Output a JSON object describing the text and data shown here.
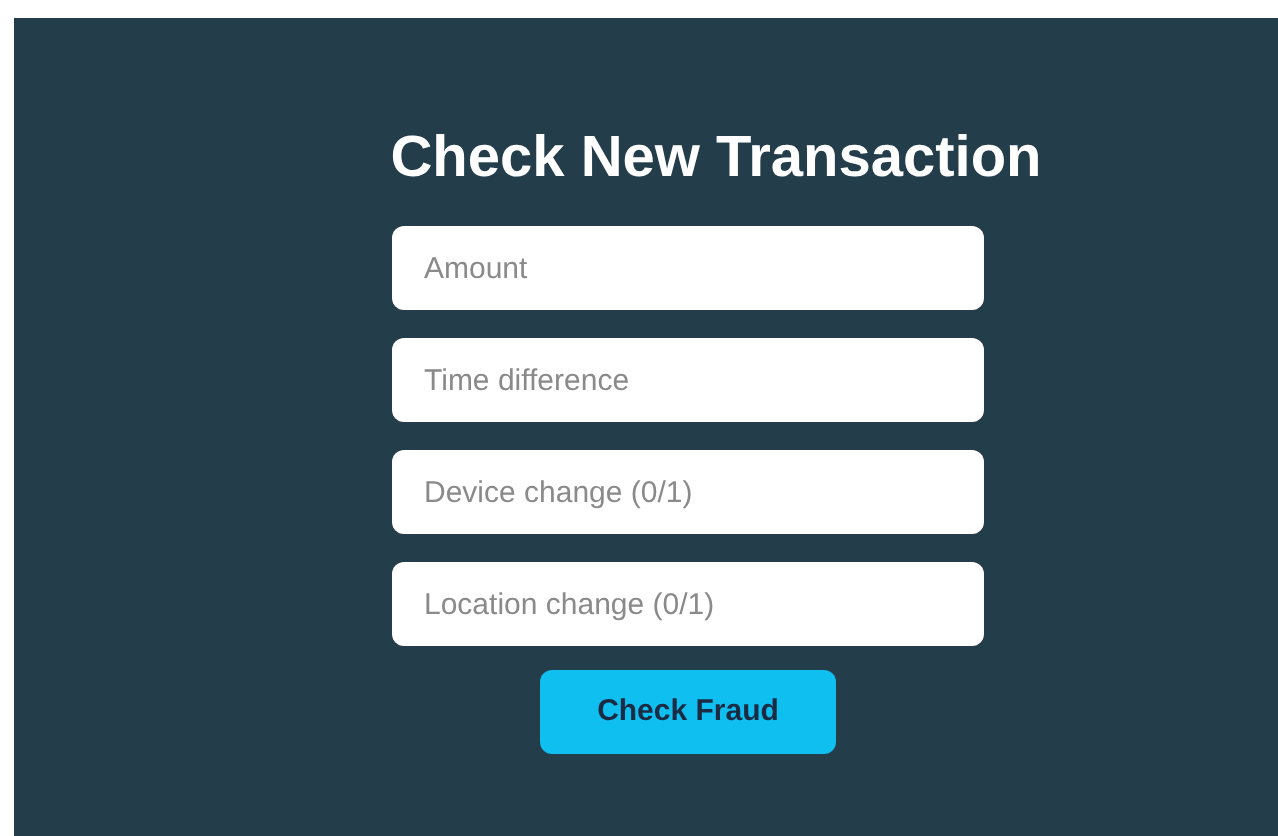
{
  "title": "Check New Transaction",
  "fields": [
    {
      "placeholder": "Amount"
    },
    {
      "placeholder": "Time difference"
    },
    {
      "placeholder": "Device change (0/1)"
    },
    {
      "placeholder": "Location change (0/1)"
    }
  ],
  "button": "Check Fraud"
}
